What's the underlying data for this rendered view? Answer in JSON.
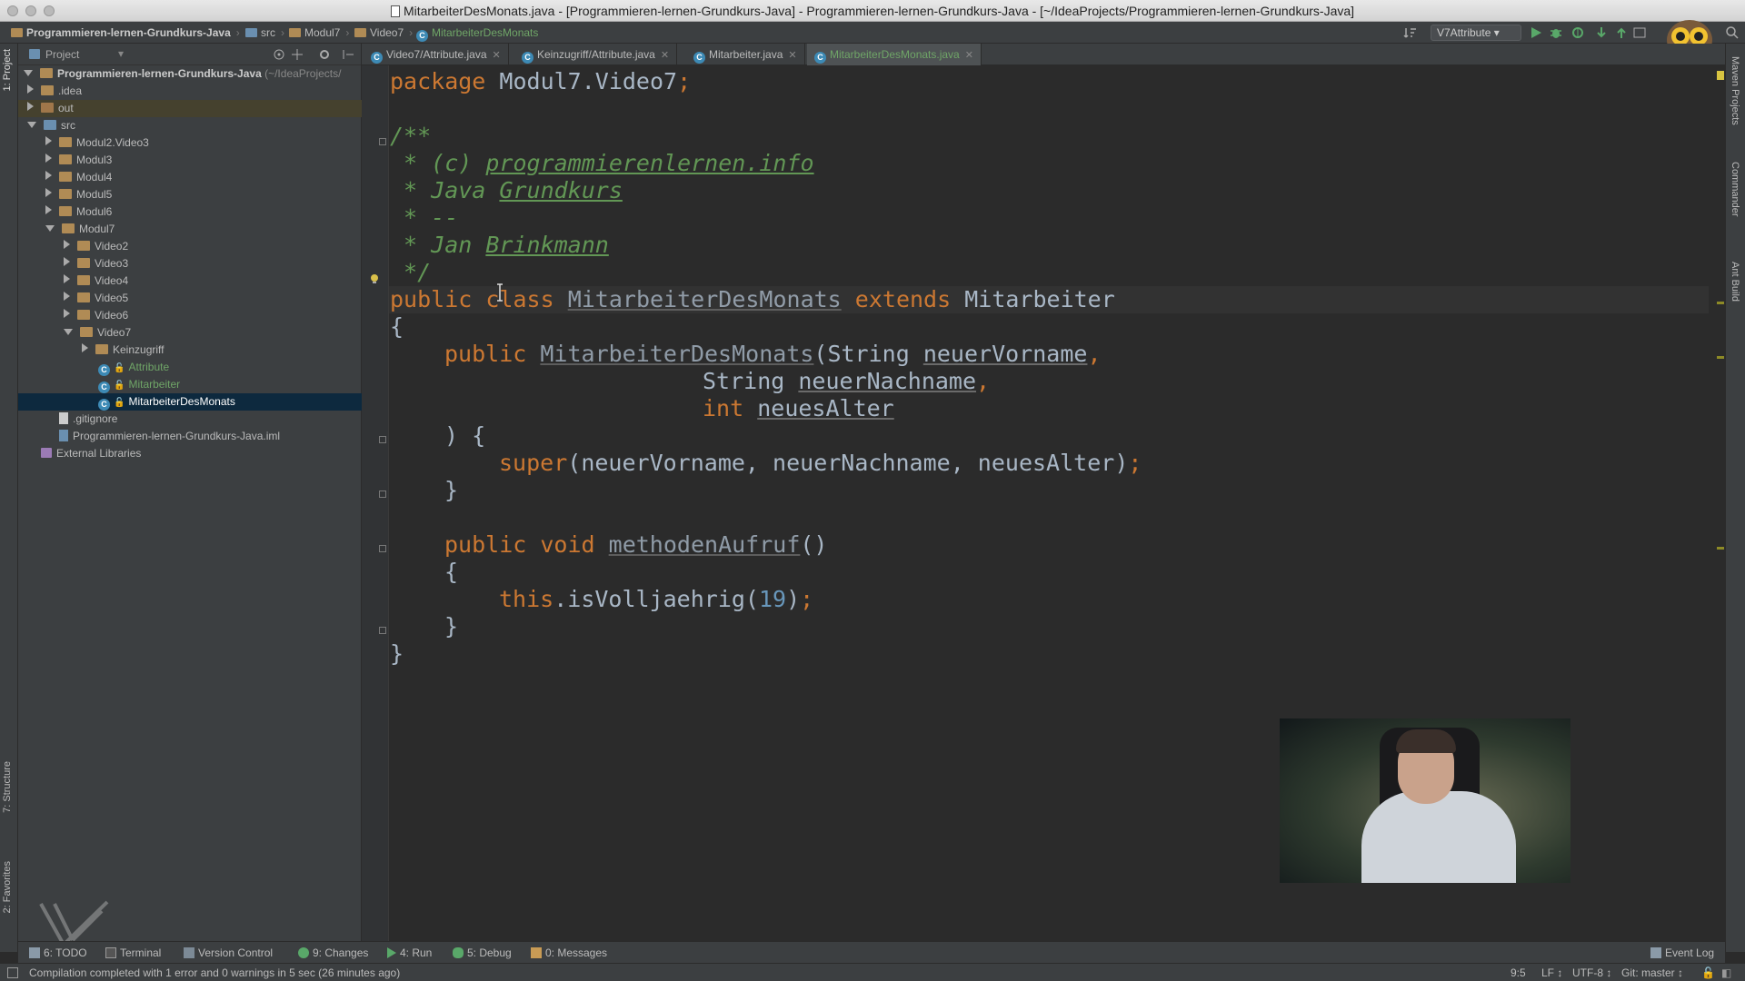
{
  "window": {
    "title": "MitarbeiterDesMonats.java - [Programmieren-lernen-Grundkurs-Java] - Programmieren-lernen-Grundkurs-Java - [~/IdeaProjects/Programmieren-lernen-Grundkurs-Java]"
  },
  "breadcrumbs": [
    {
      "label": "Programmieren-lernen-Grundkurs-Java"
    },
    {
      "label": "src"
    },
    {
      "label": "Modul7"
    },
    {
      "label": "Video7"
    },
    {
      "label": "MitarbeiterDesMonats"
    }
  ],
  "toolbar": {
    "run_config": "V7Attribute"
  },
  "left_stripe": {
    "project_tab": "1: Project",
    "structure_tab": "7: Structure",
    "favorites_tab": "2: Favorites"
  },
  "right_stripe": {
    "maven_tab": "Maven Projects",
    "commander_tab": "Commander",
    "ant_tab": "Ant Build"
  },
  "project_panel": {
    "header": "Project",
    "root_name": "Programmieren-lernen-Grundkurs-Java",
    "root_path": "(~/IdeaProjects/",
    "tree": [
      {
        "label": ".idea"
      },
      {
        "label": "out"
      },
      {
        "label": "src"
      },
      {
        "label": "Modul2.Video3"
      },
      {
        "label": "Modul3"
      },
      {
        "label": "Modul4"
      },
      {
        "label": "Modul5"
      },
      {
        "label": "Modul6"
      },
      {
        "label": "Modul7"
      },
      {
        "label": "Video2"
      },
      {
        "label": "Video3"
      },
      {
        "label": "Video4"
      },
      {
        "label": "Video5"
      },
      {
        "label": "Video6"
      },
      {
        "label": "Video7"
      },
      {
        "label": "Keinzugriff"
      },
      {
        "label": "Attribute"
      },
      {
        "label": "Mitarbeiter"
      },
      {
        "label": "MitarbeiterDesMonats"
      },
      {
        "label": ".gitignore"
      },
      {
        "label": "Programmieren-lernen-Grundkurs-Java.iml"
      },
      {
        "label": "External Libraries"
      }
    ]
  },
  "tabs": [
    {
      "label": "Video7/Attribute.java"
    },
    {
      "label": "Keinzugriff/Attribute.java"
    },
    {
      "label": "Mitarbeiter.java"
    },
    {
      "label": "MitarbeiterDesMonats.java"
    }
  ],
  "code": {
    "l1_kw": "package",
    "l1_rest": " Modul7.Video7",
    "l1_semi": ";",
    "c1": "/**",
    "c2a": " * (c) ",
    "c2b": "programmierenlernen.info",
    "c3a": " * Java ",
    "c3b": "Grundkurs",
    "c4": " * --",
    "c5a": " * Jan ",
    "c5b": "Brinkmann",
    "c6": " */",
    "cls_kw1": "public",
    "cls_kw2": "class",
    "cls_name": "MitarbeiterDesMonats",
    "cls_kw3": "extends",
    "cls_super": "Mitarbeiter",
    "brace_open": "{",
    "ctor_kw": "public",
    "ctor_name": "MitarbeiterDesMonats",
    "p1_type": "(String ",
    "p1_name": "neuerVorname",
    "p2_type": "String ",
    "p2_name": "neuerNachname",
    "p3_type": "int",
    "p3_name": "neuesAlter",
    "comma": ",",
    "ctor_close": ") {",
    "super_kw": "super",
    "super_args": "(neuerVorname, neuerNachname, neuesAlter)",
    "semi": ";",
    "brace_close": "}",
    "m_kw1": "public",
    "m_kw2": "void",
    "m_name": "methodenAufruf",
    "m_parens": "()",
    "this_kw": "this",
    "call": ".isVolljaehrig(",
    "call_num": "19",
    "call_close": ")"
  },
  "bottom_tools": {
    "todo": "6: TODO",
    "terminal": "Terminal",
    "vcs": "Version Control",
    "changes": "9: Changes",
    "run": "4: Run",
    "debug": "5: Debug",
    "messages": "0: Messages",
    "event_log": "Event Log"
  },
  "status": {
    "message": "Compilation completed with 1 error and 0 warnings in 5 sec (26 minutes ago)",
    "position": "9:5",
    "line_sep": "LF ↕",
    "encoding": "UTF-8 ↕",
    "git": "Git: master ↕"
  },
  "colors": {
    "keyword": "#cc7832",
    "comment": "#629755",
    "number": "#6897bb",
    "function": "#ffc66d",
    "text": "#a9b7c6",
    "background": "#2b2b2b",
    "panel": "#3c3f41",
    "selection": "#0d293e"
  }
}
